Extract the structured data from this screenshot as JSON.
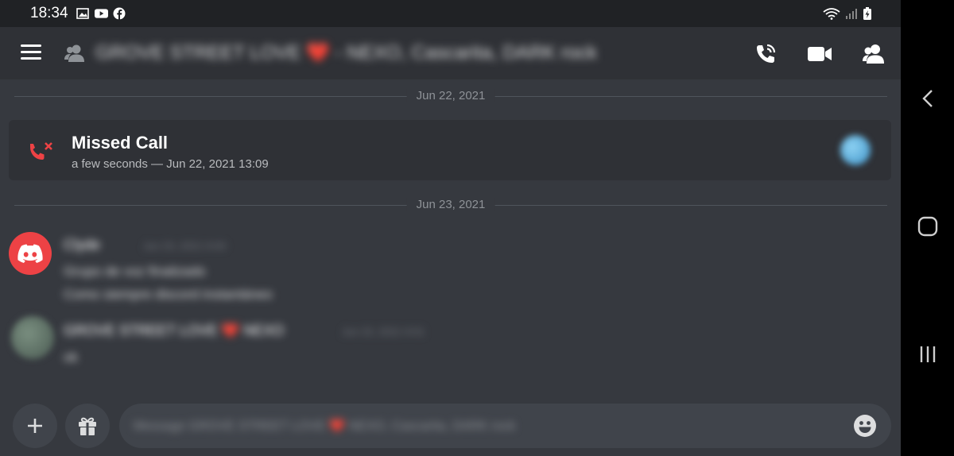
{
  "status_bar": {
    "time": "18:34",
    "left_icons": [
      "image-icon",
      "youtube-icon",
      "facebook-icon"
    ],
    "right_icons": [
      "wifi-icon",
      "signal-icon",
      "battery-charging-icon"
    ]
  },
  "header": {
    "title": "GROVE STREET LOVE ❤️ - NEXO, Cascarita, DARK rock",
    "buttons": [
      "menu-icon",
      "group-dm-icon",
      "voice-call-icon",
      "video-call-icon",
      "members-icon"
    ]
  },
  "dividers": [
    {
      "label": "Jun 22, 2021"
    },
    {
      "label": "Jun 23, 2021"
    }
  ],
  "missed_call": {
    "title": "Missed Call",
    "subtitle": "a few seconds — Jun 22, 2021 13:09"
  },
  "messages": [
    {
      "author": "Clyde",
      "timestamp": "Jun 23, 2021 9:00",
      "lines": [
        "Grupo de voz finalizado",
        "Como siempre discord instantáneo"
      ]
    },
    {
      "author": "GROVE STREET LOVE ❤️ NEXO",
      "timestamp": "Jun 23, 2021 9:01",
      "lines": [
        "ok"
      ]
    }
  ],
  "composer": {
    "placeholder": "Message GROVE STREET LOVE ❤️ NEXO, Cascarita, DARK rock"
  },
  "colors": {
    "background": "#36393f",
    "header": "#2f3136",
    "missed_red": "#ed4245",
    "input": "#40444b"
  }
}
